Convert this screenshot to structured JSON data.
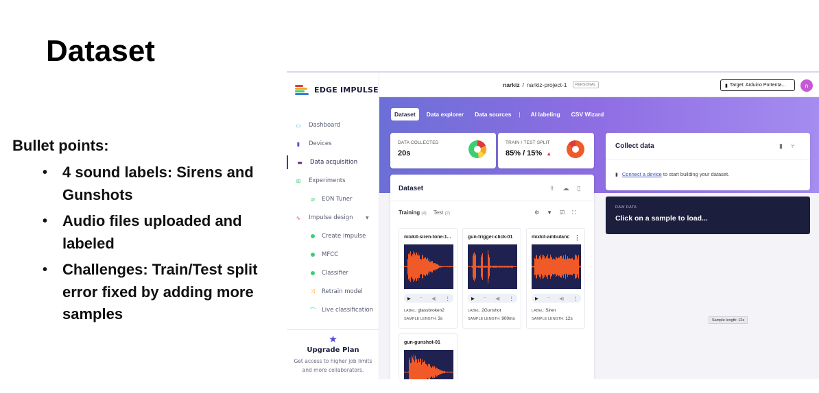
{
  "slide": {
    "title": "Dataset",
    "bullets_heading": "Bullet points:",
    "bullets": [
      "4 sound labels: Sirens and Gunshots",
      "Audio files uploaded and labeled",
      "Challenges: Train/Test split error fixed by adding more samples"
    ]
  },
  "app": {
    "logo_text": "EDGE IMPULSE",
    "logo_colors": [
      "#e03a3a",
      "#f5a623",
      "#3ccf72",
      "#3a7bd5"
    ],
    "sidebar": {
      "items": [
        {
          "label": "Dashboard",
          "icon": "monitor-icon"
        },
        {
          "label": "Devices",
          "icon": "device-icon"
        },
        {
          "label": "Data acquisition",
          "icon": "database-icon"
        },
        {
          "label": "Experiments",
          "icon": "grid-icon"
        },
        {
          "label": "EON Tuner",
          "icon": "tuner-icon"
        },
        {
          "label": "Impulse design",
          "icon": "pulse-icon"
        },
        {
          "label": "Create impulse",
          "icon": "dot-icon"
        },
        {
          "label": "MFCC",
          "icon": "dot-icon"
        },
        {
          "label": "Classifier",
          "icon": "dot-icon"
        },
        {
          "label": "Retrain model",
          "icon": "shuffle-icon"
        },
        {
          "label": "Live classification",
          "icon": "live-icon"
        }
      ],
      "upgrade": {
        "title": "Upgrade Plan",
        "desc": "Get access to higher job limits and more collaborators."
      }
    },
    "topbar": {
      "owner": "narkiz",
      "separator": "/",
      "project": "narkiz-project-1",
      "badge": "PERSONAL",
      "target": "Target: Arduino Portenta...",
      "avatar": "n"
    },
    "tabs": {
      "dataset": "Dataset",
      "explorer": "Data explorer",
      "sources": "Data sources",
      "sep": "|",
      "ai": "AI labeling",
      "csv": "CSV Wizard"
    },
    "stats": {
      "collected_label": "DATA COLLECTED",
      "collected_value": "20s",
      "split_label": "TRAIN / TEST SPLIT",
      "split_value": "85% / 15%",
      "split_warning": "▲",
      "split_train_fraction": 0.85
    },
    "dataset_card": {
      "title": "Dataset",
      "training_label": "Training",
      "training_count": "(4)",
      "test_label": "Test",
      "test_count": "(2)"
    },
    "samples": [
      {
        "name": "mixkit-siren-tone-1...",
        "label_key": "LABEL:",
        "label": "glassbroken2",
        "length_key": "SAMPLE LENGTH:",
        "length": "3s"
      },
      {
        "name": "gun-trigger-click-01",
        "label_key": "LABEL:",
        "label": "2Gunshot",
        "length_key": "SAMPLE LENGTH:",
        "length": "900ms"
      },
      {
        "name": "mixkit-ambulanc",
        "label_key": "LABEL:",
        "label": "Siren",
        "length_key": "SAMPLE LENGTH:",
        "length": "12s"
      },
      {
        "name": "gun-gunshot-01",
        "label_key": "",
        "label": "",
        "length_key": "",
        "length": ""
      }
    ],
    "collect": {
      "title": "Collect data",
      "link": "Connect a device",
      "rest": " to start building your dataset."
    },
    "raw": {
      "label": "RAW DATA",
      "text": "Click on a sample to load..."
    },
    "tooltip": "Sample length: 12s",
    "colors": {
      "accent": "#6c6fd6",
      "wave": "#f05a28",
      "wave_bg": "#1f2250",
      "navy": "#1b1e3c"
    }
  }
}
